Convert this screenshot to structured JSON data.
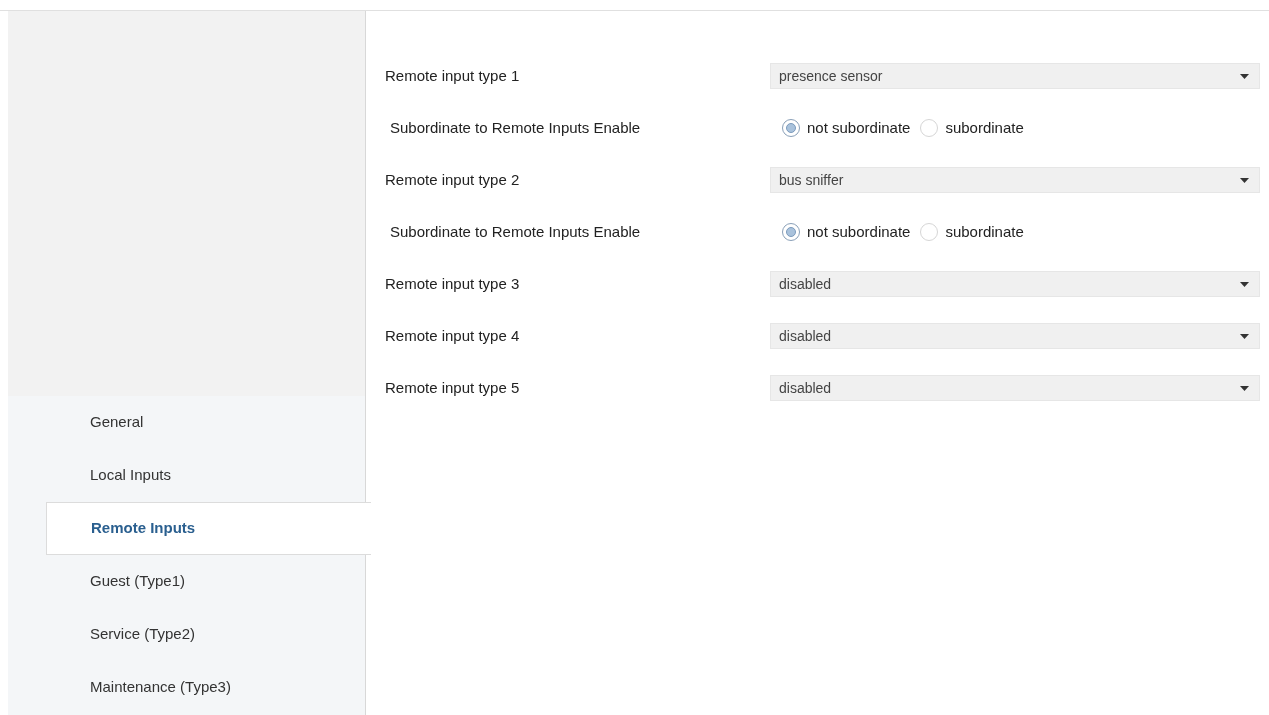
{
  "sidebar": {
    "items": [
      {
        "label": "General",
        "selected": false
      },
      {
        "label": "Local Inputs",
        "selected": false
      },
      {
        "label": "Remote Inputs",
        "selected": true
      },
      {
        "label": "Guest (Type1)",
        "selected": false
      },
      {
        "label": "Service (Type2)",
        "selected": false
      },
      {
        "label": "Maintenance (Type3)",
        "selected": false
      }
    ]
  },
  "parameters": [
    {
      "kind": "dropdown",
      "label": "Remote input type 1",
      "value": "presence sensor"
    },
    {
      "kind": "radio",
      "label": "Subordinate to Remote Inputs Enable",
      "options": [
        {
          "label": "not subordinate",
          "selected": true
        },
        {
          "label": "subordinate",
          "selected": false
        }
      ]
    },
    {
      "kind": "dropdown",
      "label": "Remote input type 2",
      "value": "bus sniffer"
    },
    {
      "kind": "radio",
      "label": "Subordinate to Remote Inputs Enable",
      "options": [
        {
          "label": "not subordinate",
          "selected": true
        },
        {
          "label": "subordinate",
          "selected": false
        }
      ]
    },
    {
      "kind": "dropdown",
      "label": "Remote input type 3",
      "value": "disabled"
    },
    {
      "kind": "dropdown",
      "label": "Remote input type 4",
      "value": "disabled"
    },
    {
      "kind": "dropdown",
      "label": "Remote input type 5",
      "value": "disabled"
    }
  ]
}
